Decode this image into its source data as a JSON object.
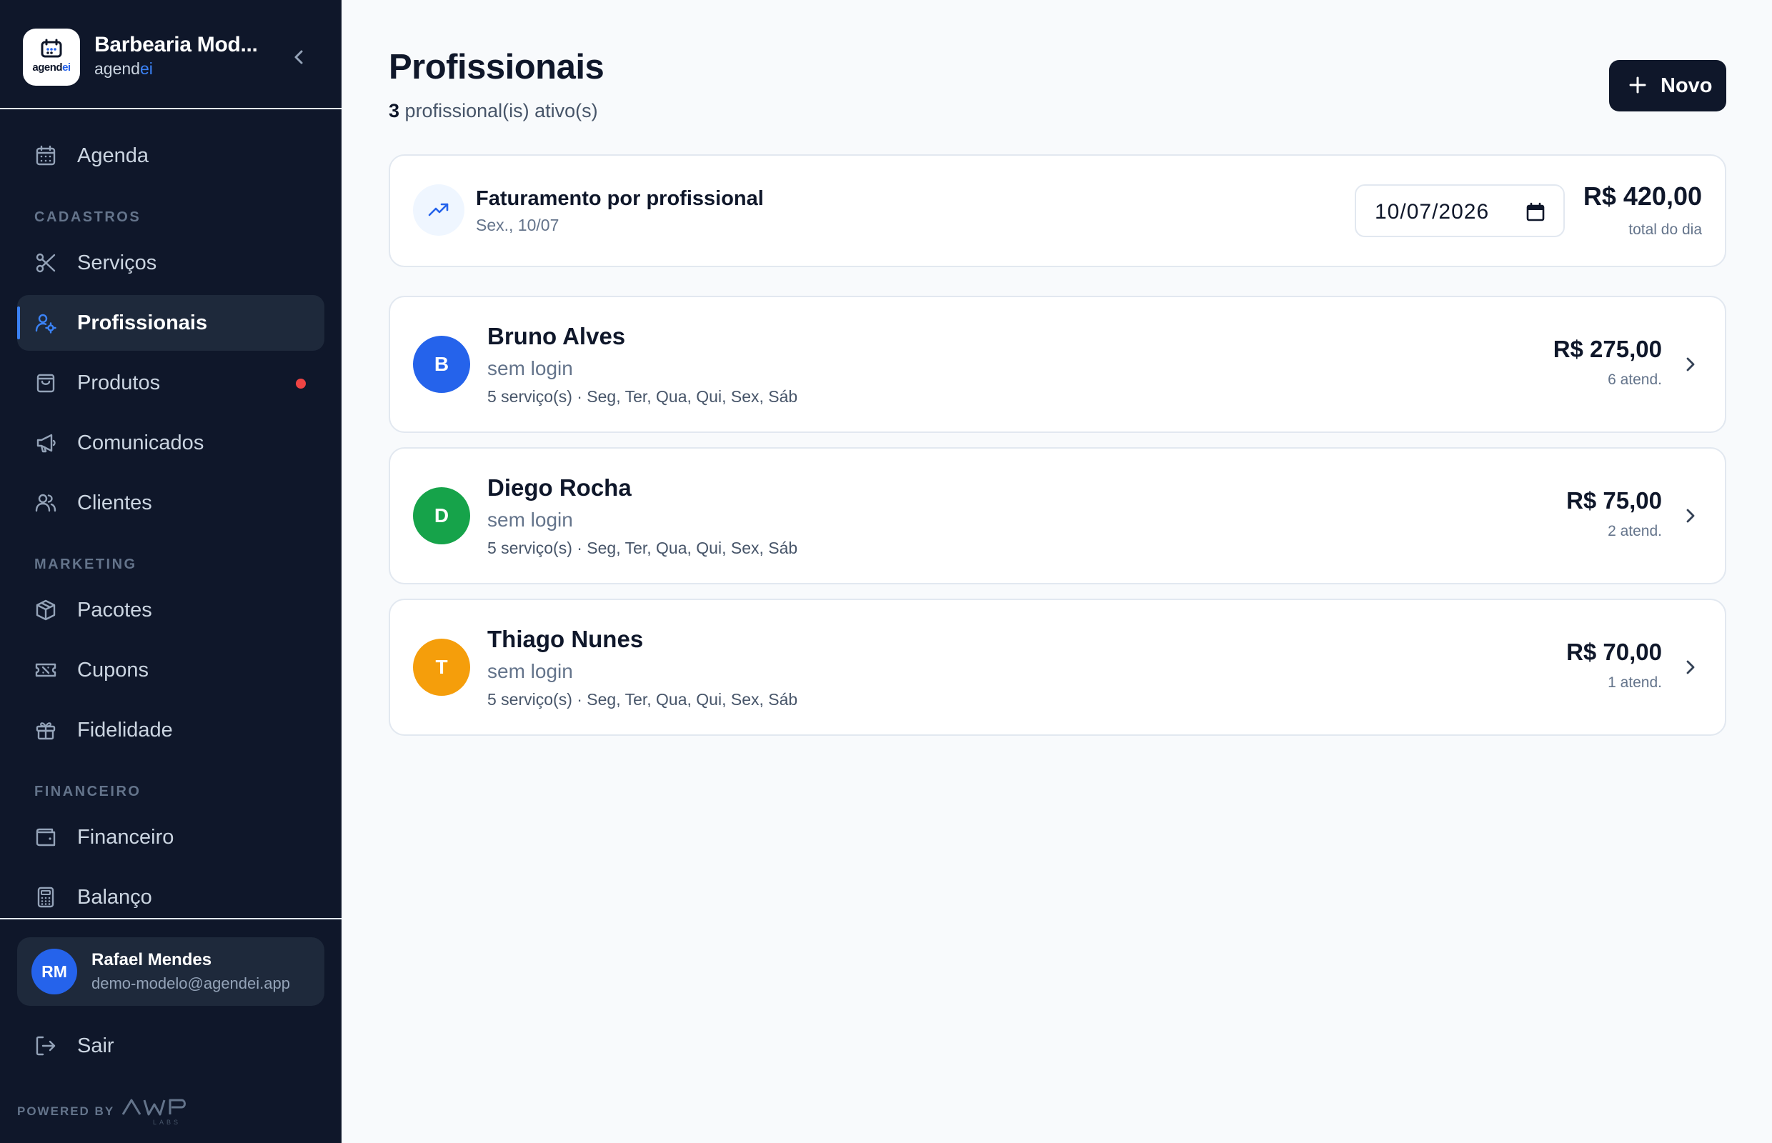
{
  "brand": {
    "name": "Barbearia Mod...",
    "sub_prefix": "agend",
    "sub_accent": "ei",
    "logo_prefix": "agend",
    "logo_accent": "ei"
  },
  "nav": {
    "agenda": "Agenda",
    "section_cadastros": "CADASTROS",
    "servicos": "Serviços",
    "profissionais": "Profissionais",
    "produtos": "Produtos",
    "comunicados": "Comunicados",
    "clientes": "Clientes",
    "section_marketing": "MARKETING",
    "pacotes": "Pacotes",
    "cupons": "Cupons",
    "fidelidade": "Fidelidade",
    "section_financeiro": "FINANCEIRO",
    "financeiro": "Financeiro",
    "balanco": "Balanço",
    "active_item": "profissionais",
    "produtos_badge_color": "#ef4444"
  },
  "user": {
    "initials": "RM",
    "name": "Rafael Mendes",
    "email": "demo-modelo@agendei.app"
  },
  "logout_label": "Sair",
  "powered_by": "POWERED BY",
  "powered_logo_text": "AWP LABS",
  "header": {
    "title": "Profissionais",
    "active_count": "3",
    "active_suffix": "profissional(is) ativo(s)",
    "new_button": "Novo"
  },
  "revenue": {
    "title": "Faturamento por profissional",
    "date_label": "Sex., 10/07",
    "date_value": "10/07/2026",
    "total": "R$ 420,00",
    "total_label": "total do dia"
  },
  "professionals": [
    {
      "initial": "B",
      "name": "Bruno Alves",
      "login": "sem login",
      "meta": "5 serviço(s) · Seg, Ter, Qua, Qui, Sex, Sáb",
      "amount": "R$ 275,00",
      "count": "6 atend.",
      "color": "#2563eb"
    },
    {
      "initial": "D",
      "name": "Diego Rocha",
      "login": "sem login",
      "meta": "5 serviço(s) · Seg, Ter, Qua, Qui, Sex, Sáb",
      "amount": "R$ 75,00",
      "count": "2 atend.",
      "color": "#16a34a"
    },
    {
      "initial": "T",
      "name": "Thiago Nunes",
      "login": "sem login",
      "meta": "5 serviço(s) · Seg, Ter, Qua, Qui, Sex, Sáb",
      "amount": "R$ 70,00",
      "count": "1 atend.",
      "color": "#f59e0b"
    }
  ],
  "colors": {
    "sidebar_bg": "#0f172a",
    "accent": "#2563eb",
    "primary_button": "#0f172a"
  }
}
